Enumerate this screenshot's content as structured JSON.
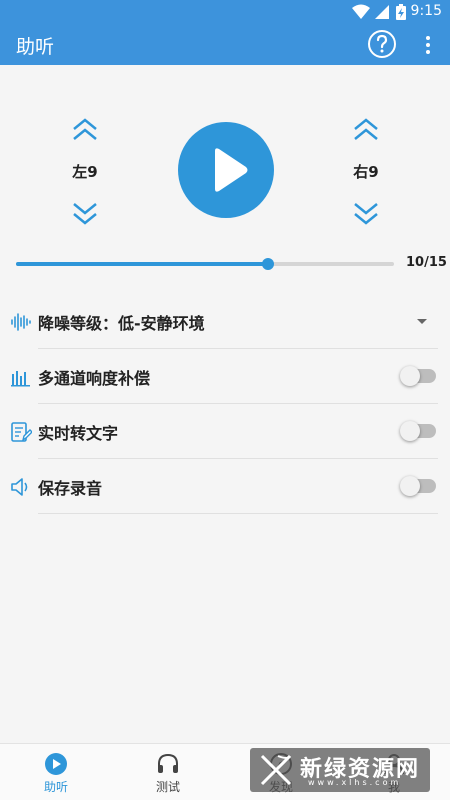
{
  "status_bar": {
    "time": "9:15"
  },
  "app_bar": {
    "title": "助听"
  },
  "volume": {
    "left_label": "左9",
    "right_label": "右9"
  },
  "slider": {
    "value": 10,
    "max": 15,
    "display": "10/15"
  },
  "settings": {
    "noise_reduction": {
      "label": "降噪等级：低-安静环境"
    },
    "multichannel": {
      "label": "多通道响度补偿",
      "enabled": false
    },
    "speech_to_text": {
      "label": "实时转文字",
      "enabled": false
    },
    "save_recording": {
      "label": "保存录音",
      "enabled": false
    }
  },
  "bottom_nav": [
    {
      "label": "助听",
      "icon": "play-circle-icon",
      "active": true
    },
    {
      "label": "测试",
      "icon": "headphones-icon",
      "active": false
    },
    {
      "label": "发现",
      "icon": "discover-icon",
      "active": false
    },
    {
      "label": "我",
      "icon": "user-icon",
      "active": false
    }
  ],
  "watermark": {
    "main": "新绿资源网",
    "sub": "www.xlhs.com"
  },
  "colors": {
    "primary": "#3d93dc",
    "accent": "#2e96d9"
  }
}
